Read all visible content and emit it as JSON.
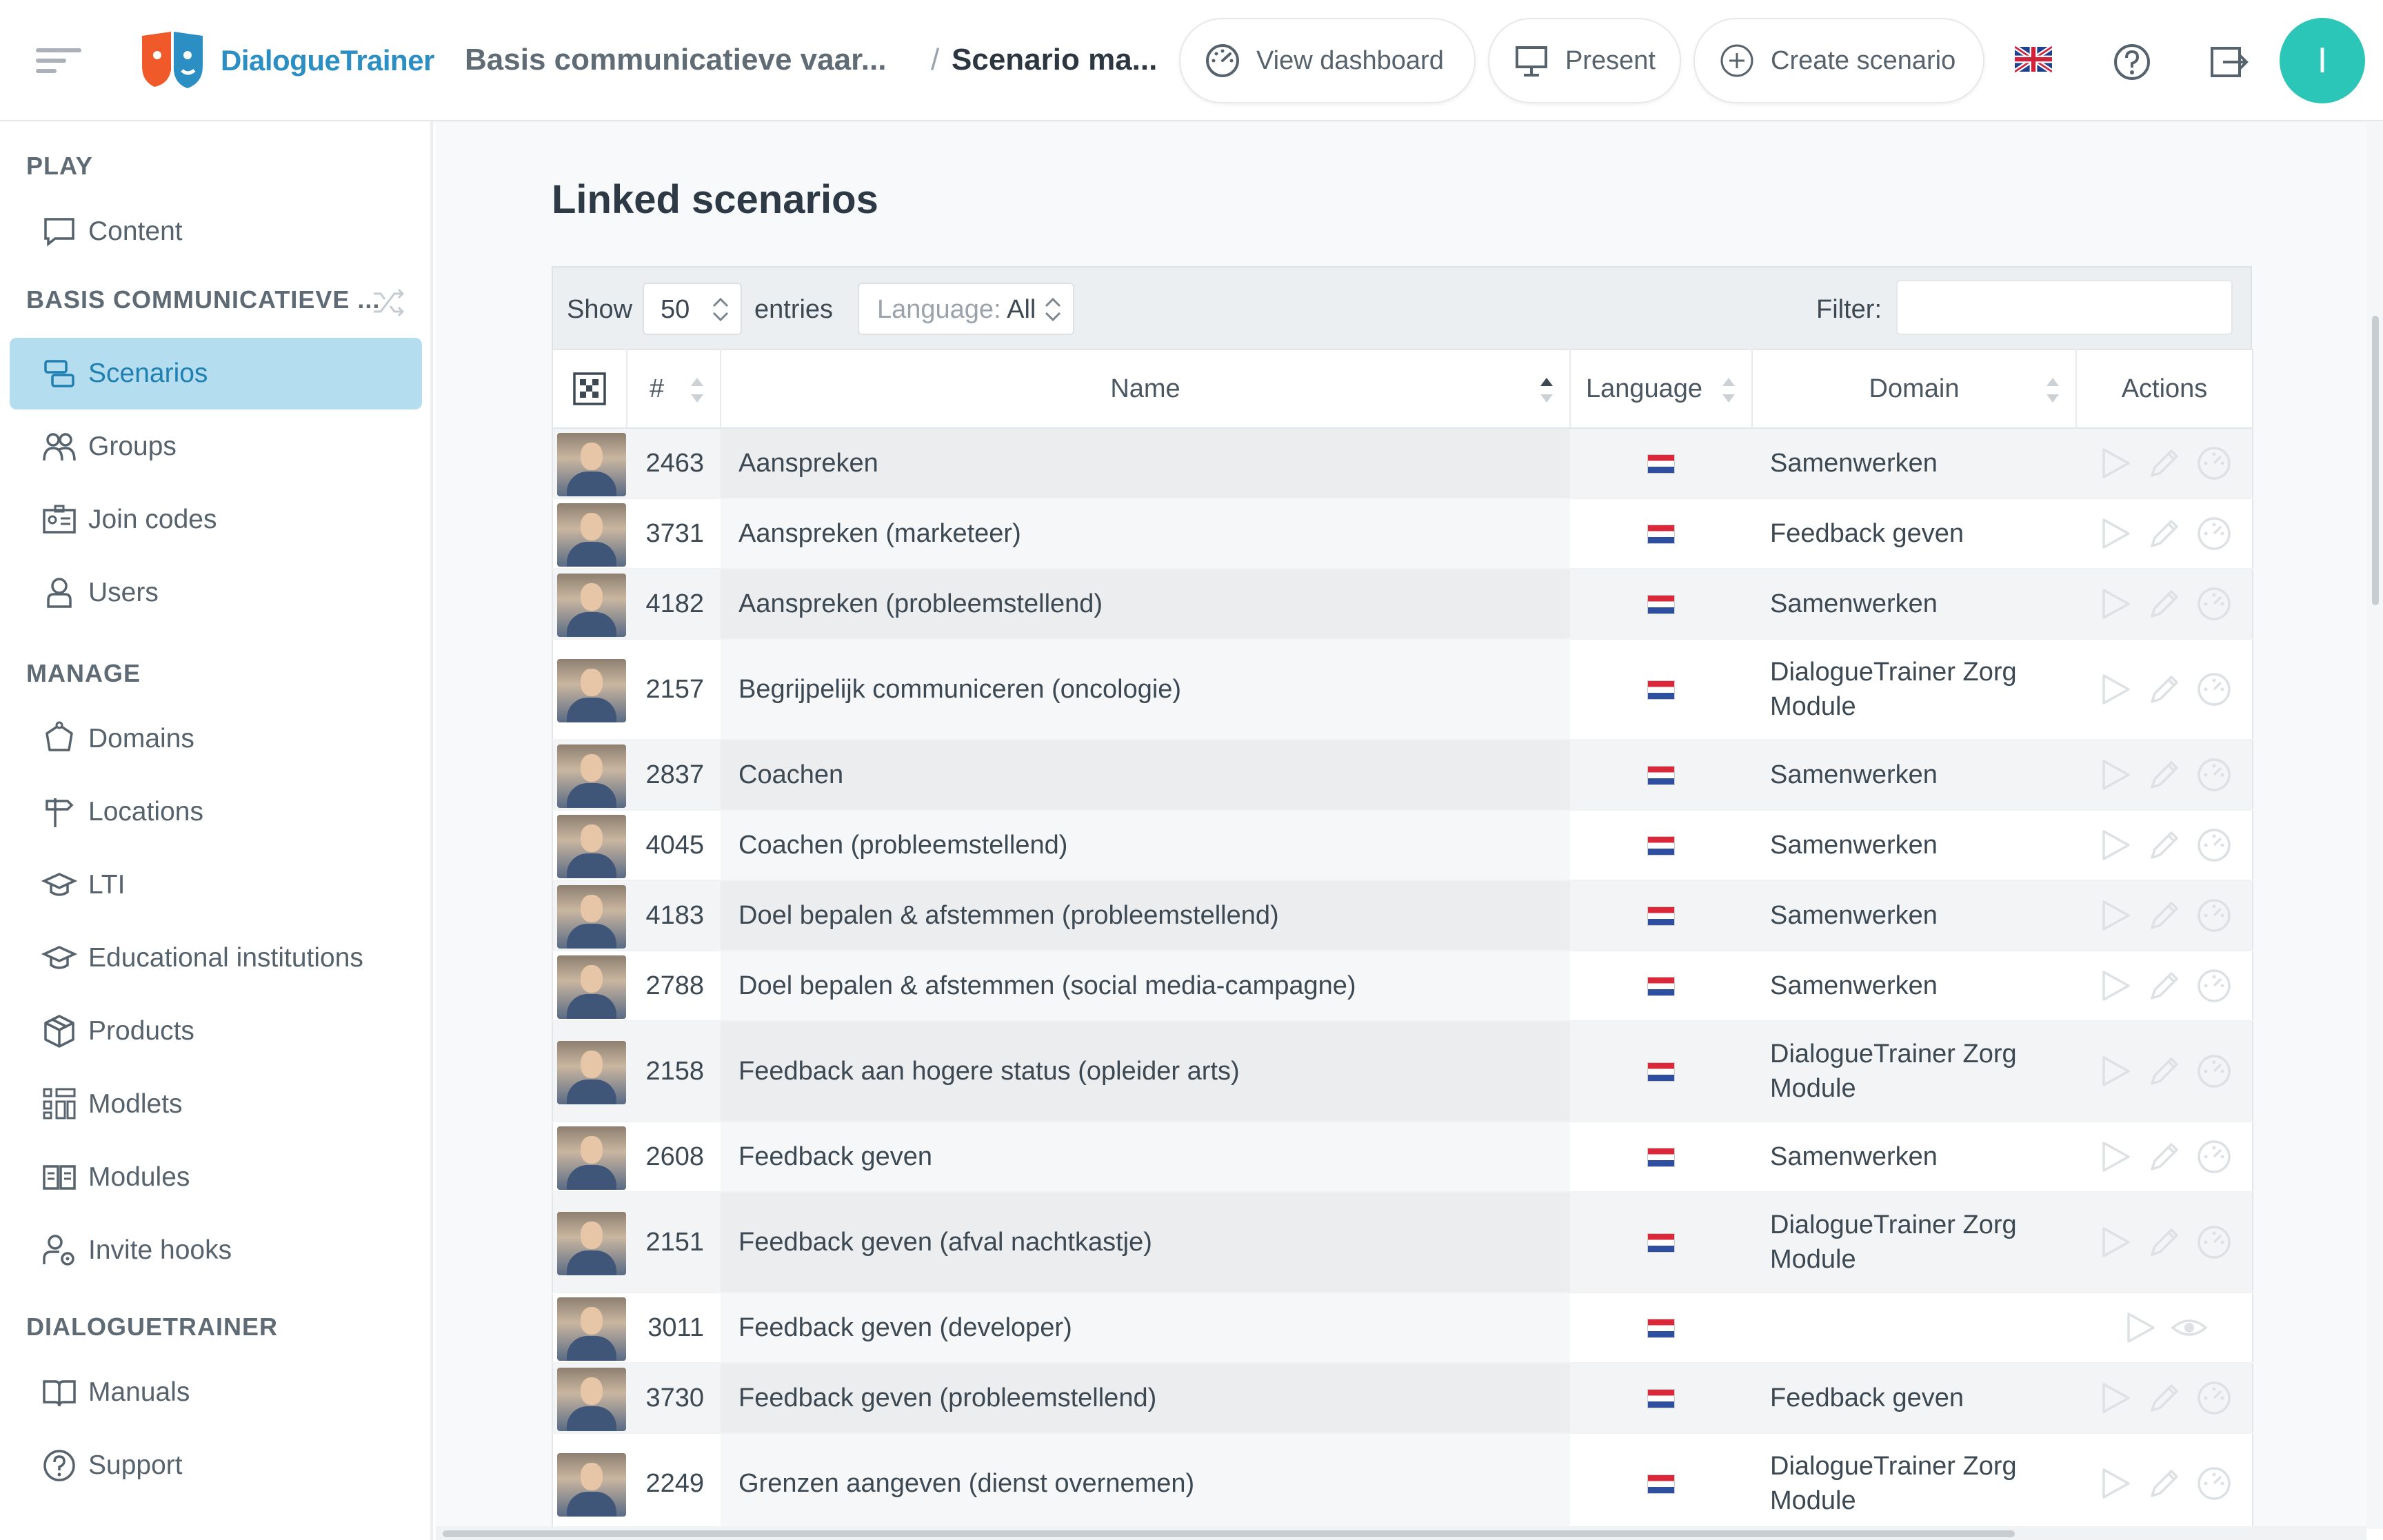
{
  "header": {
    "logo_text": "DialogueTrainer",
    "breadcrumb_1": "Basis communicatieve vaar...",
    "breadcrumb_sep": "/",
    "breadcrumb_2": "Scenario ma...",
    "view_dashboard": "View dashboard",
    "present": "Present",
    "create_scenario": "Create scenario",
    "user_initial": "I",
    "avatar_color": "#2bc6b8"
  },
  "sidebar": {
    "play_title": "PLAY",
    "content": "Content",
    "org_title": "BASIS COMMUNICATIEVE ...",
    "scenarios": "Scenarios",
    "groups": "Groups",
    "join_codes": "Join codes",
    "users": "Users",
    "manage_title": "MANAGE",
    "domains": "Domains",
    "locations": "Locations",
    "lti": "LTI",
    "educational_institutions": "Educational institutions",
    "products": "Products",
    "modlets": "Modlets",
    "modules": "Modules",
    "invite_hooks": "Invite hooks",
    "dt_title": "DIALOGUETRAINER",
    "manuals": "Manuals",
    "support": "Support"
  },
  "main": {
    "title": "Linked scenarios",
    "show_label": "Show",
    "show_value": "50",
    "entries_label": "entries",
    "language_label": "Language:",
    "language_value": "All",
    "filter_label": "Filter:",
    "columns": {
      "id": "#",
      "name": "Name",
      "language": "Language",
      "domain": "Domain",
      "actions": "Actions"
    }
  },
  "rows": [
    {
      "id": "2463",
      "name": "Aanspreken",
      "language": "nl",
      "domain": "Samenwerken",
      "actions": [
        "play",
        "edit",
        "dashboard"
      ]
    },
    {
      "id": "3731",
      "name": "Aanspreken (marketeer)",
      "language": "nl",
      "domain": "Feedback geven",
      "actions": [
        "play",
        "edit",
        "dashboard"
      ]
    },
    {
      "id": "4182",
      "name": "Aanspreken (probleemstellend)",
      "language": "nl",
      "domain": "Samenwerken",
      "actions": [
        "play",
        "edit",
        "dashboard"
      ]
    },
    {
      "id": "2157",
      "name": "Begrijpelijk communiceren (oncologie)",
      "language": "nl",
      "domain": "DialogueTrainer Zorg Module",
      "actions": [
        "play",
        "edit",
        "dashboard"
      ]
    },
    {
      "id": "2837",
      "name": "Coachen",
      "language": "nl",
      "domain": "Samenwerken",
      "actions": [
        "play",
        "edit",
        "dashboard"
      ]
    },
    {
      "id": "4045",
      "name": "Coachen (probleemstellend)",
      "language": "nl",
      "domain": "Samenwerken",
      "actions": [
        "play",
        "edit",
        "dashboard"
      ]
    },
    {
      "id": "4183",
      "name": "Doel bepalen & afstemmen (probleemstellend)",
      "language": "nl",
      "domain": "Samenwerken",
      "actions": [
        "play",
        "edit",
        "dashboard"
      ]
    },
    {
      "id": "2788",
      "name": "Doel bepalen & afstemmen (social media-campagne)",
      "language": "nl",
      "domain": "Samenwerken",
      "actions": [
        "play",
        "edit",
        "dashboard"
      ]
    },
    {
      "id": "2158",
      "name": "Feedback aan hogere status (opleider arts)",
      "language": "nl",
      "domain": "DialogueTrainer Zorg Module",
      "actions": [
        "play",
        "edit",
        "dashboard"
      ]
    },
    {
      "id": "2608",
      "name": "Feedback geven",
      "language": "nl",
      "domain": "Samenwerken",
      "actions": [
        "play",
        "edit",
        "dashboard"
      ]
    },
    {
      "id": "2151",
      "name": "Feedback geven (afval nachtkastje)",
      "language": "nl",
      "domain": "DialogueTrainer Zorg Module",
      "actions": [
        "play",
        "edit",
        "dashboard"
      ]
    },
    {
      "id": "3011",
      "name": "Feedback geven (developer)",
      "language": "nl",
      "domain": "",
      "actions": [
        "play",
        "view"
      ]
    },
    {
      "id": "3730",
      "name": "Feedback geven (probleemstellend)",
      "language": "nl",
      "domain": "Feedback geven",
      "actions": [
        "play",
        "edit",
        "dashboard"
      ]
    },
    {
      "id": "2249",
      "name": "Grenzen aangeven (dienst overnemen)",
      "language": "nl",
      "domain": "DialogueTrainer Zorg Module",
      "actions": [
        "play",
        "edit",
        "dashboard"
      ]
    }
  ]
}
